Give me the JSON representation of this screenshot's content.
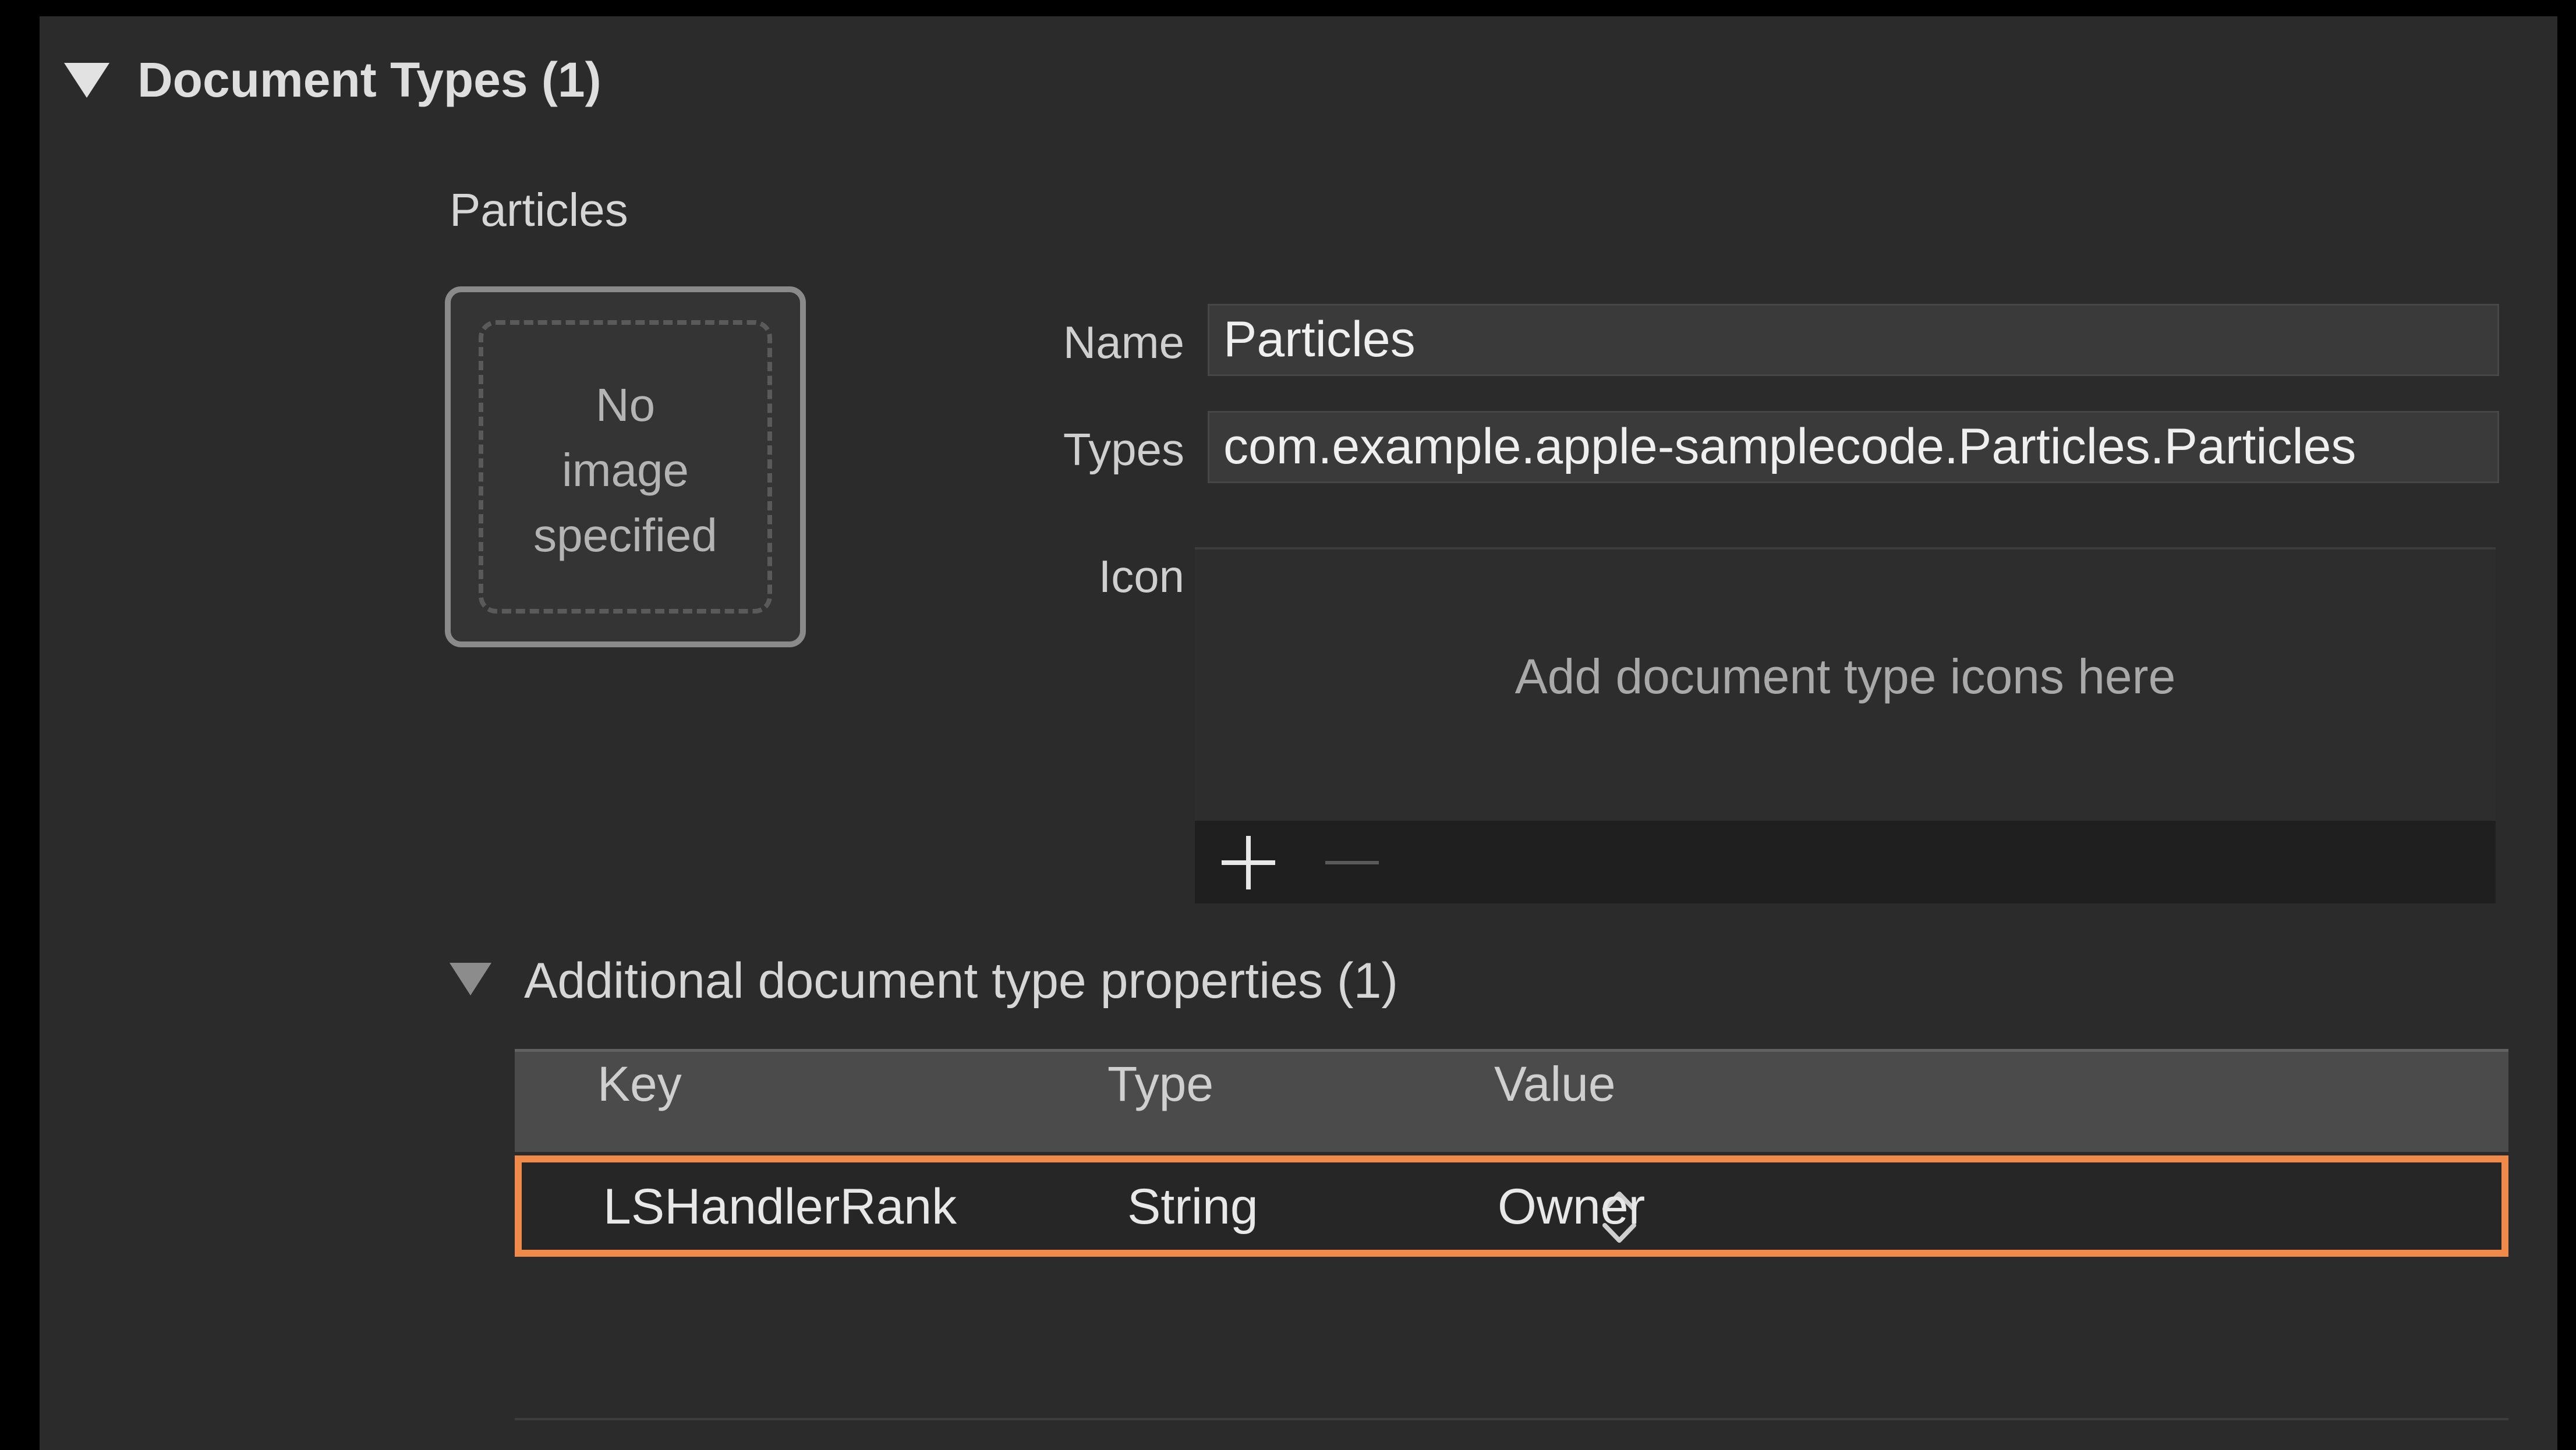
{
  "section": {
    "title": "Document Types (1)"
  },
  "document": {
    "heading": "Particles",
    "image_placeholder": "No\nimage\nspecified"
  },
  "form": {
    "name_label": "Name",
    "name_value": "Particles",
    "types_label": "Types",
    "types_value": "com.example.apple-samplecode.Particles.Particles",
    "icon_label": "Icon",
    "icon_drop_text": "Add document type icons here"
  },
  "additional": {
    "title": "Additional document type properties (1)",
    "columns": [
      "Key",
      "Type",
      "Value"
    ],
    "rows": [
      {
        "key": "LSHandlerRank",
        "type": "String",
        "value": "Owner"
      }
    ]
  },
  "colors": {
    "highlight": "#f08a4b",
    "panel": "#2b2b2b"
  },
  "icons": [
    "disclosure-triangle-icon",
    "plus-icon",
    "minus-icon",
    "up-down-stepper-icon"
  ]
}
